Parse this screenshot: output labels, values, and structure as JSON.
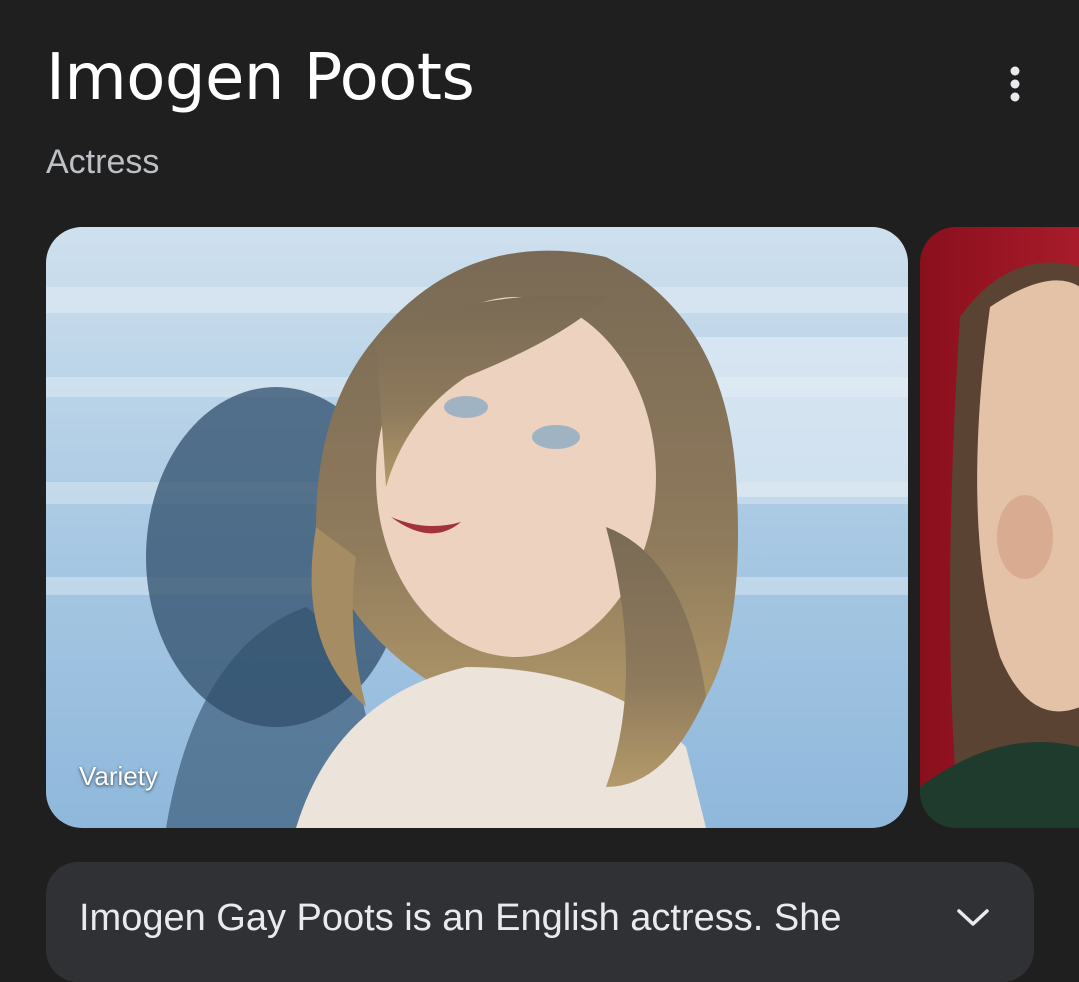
{
  "header": {
    "title": "Imogen Poots",
    "subtitle": "Actress",
    "more_icon": "more-vert-icon"
  },
  "images": [
    {
      "source": "Variety"
    },
    {
      "source": ""
    }
  ],
  "description": {
    "text": "Imogen Gay Poots is an English actress. She",
    "expand_icon": "chevron-down-icon"
  },
  "colors": {
    "background": "#1f1f1f",
    "card": "#303134",
    "text_primary": "#ffffff",
    "text_secondary": "#bdc1c6"
  }
}
